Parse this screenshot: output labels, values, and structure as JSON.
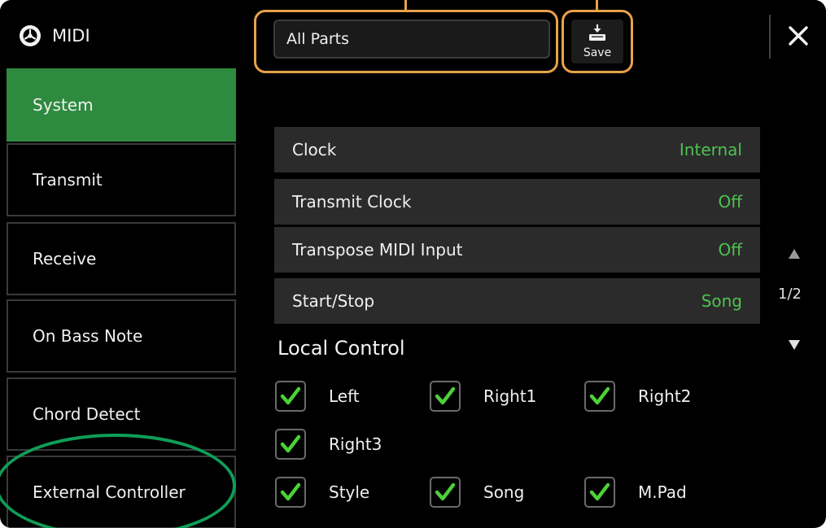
{
  "header": {
    "title": "MIDI",
    "part_selector": "All Parts",
    "save_label": "Save"
  },
  "sidebar": {
    "items": [
      {
        "label": "System",
        "active": true
      },
      {
        "label": "Transmit",
        "active": false
      },
      {
        "label": "Receive",
        "active": false
      },
      {
        "label": "On Bass Note",
        "active": false
      },
      {
        "label": "Chord Detect",
        "active": false
      },
      {
        "label": "External Controller",
        "active": false
      }
    ]
  },
  "settings": [
    {
      "label": "Clock",
      "value": "Internal"
    },
    {
      "label": "Transmit Clock",
      "value": "Off"
    },
    {
      "label": "Transpose MIDI Input",
      "value": "Off"
    },
    {
      "label": "Start/Stop",
      "value": "Song"
    }
  ],
  "local_control": {
    "title": "Local Control",
    "items": [
      {
        "label": "Left",
        "checked": true
      },
      {
        "label": "Right1",
        "checked": true
      },
      {
        "label": "Right2",
        "checked": true
      },
      {
        "label": "Right3",
        "checked": true
      },
      {
        "label": "Style",
        "checked": true
      },
      {
        "label": "Song",
        "checked": true
      },
      {
        "label": "M.Pad",
        "checked": true
      }
    ]
  },
  "pager": {
    "indicator": "1/2"
  },
  "colors": {
    "accent_green": "#2d8a3e",
    "value_green": "#4cc34f",
    "annotation_orange": "#e8a24a",
    "annotation_ellipse": "#0f9d58"
  }
}
